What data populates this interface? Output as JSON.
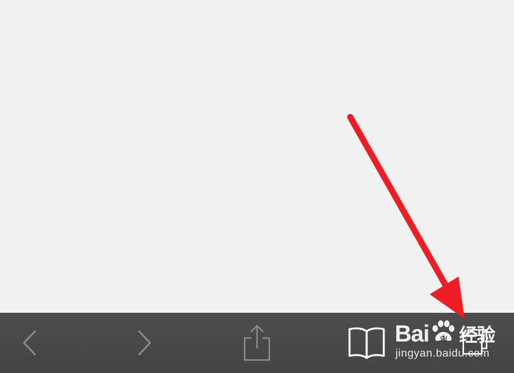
{
  "toolbar": {
    "buttons": [
      {
        "id": "back",
        "icon": "chevron-left-icon"
      },
      {
        "id": "forward",
        "icon": "chevron-right-icon"
      },
      {
        "id": "share",
        "icon": "share-icon"
      },
      {
        "id": "bookmarks",
        "icon": "open-book-icon"
      },
      {
        "id": "tabs",
        "icon": "tabs-icon"
      }
    ],
    "background": "#474747",
    "icon_color": "#8a8a8a",
    "bookmark_icon_color": "#ffffff"
  },
  "content": {
    "background": "#f2f1f2"
  },
  "annotation": {
    "type": "arrow",
    "color": "#ee1c24",
    "points_to": "tabs-button"
  },
  "watermark": {
    "logo_text_1": "Bai",
    "logo_text_2": "du",
    "logo_text_cn": "经验",
    "url": "jingyan.baidu.com"
  }
}
